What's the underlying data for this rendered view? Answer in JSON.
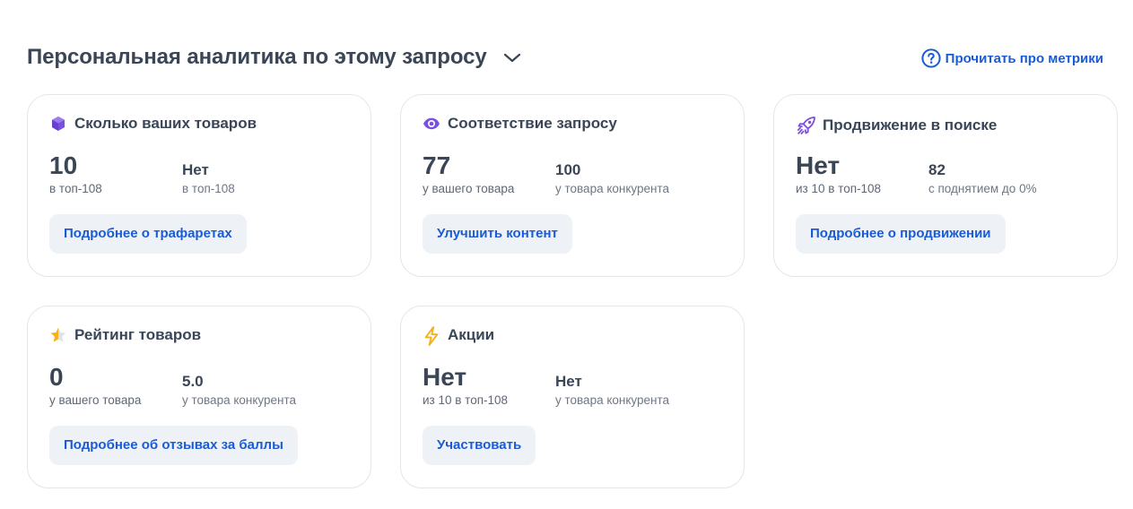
{
  "header": {
    "title": "Персональная аналитика по этому запросу",
    "help_link": "Прочитать про метрики"
  },
  "cards": [
    {
      "title": "Сколько ваших товаров",
      "icon": "cube-icon",
      "primary_value": "10",
      "primary_label": "в топ-108",
      "secondary_value": "Нет",
      "secondary_label": "в топ-108",
      "button": "Подробнее о трафаретах"
    },
    {
      "title": "Соответствие запросу",
      "icon": "eye-icon",
      "primary_value": "77",
      "primary_label": "у вашего товара",
      "secondary_value": "100",
      "secondary_label": "у товара конкурента",
      "button": "Улучшить контент"
    },
    {
      "title": "Продвижение в поиске",
      "icon": "rocket-icon",
      "primary_value": "Нет",
      "primary_label": "из 10 в топ-108",
      "secondary_value": "82",
      "secondary_label": "с поднятием до 0%",
      "button": "Подробнее о продвижении"
    },
    {
      "title": "Рейтинг товаров",
      "icon": "star-half-icon",
      "primary_value": "0",
      "primary_label": "у вашего товара",
      "secondary_value": "5.0",
      "secondary_label": "у товара конкурента",
      "button": "Подробнее об отзывах за баллы"
    },
    {
      "title": "Акции",
      "icon": "lightning-icon",
      "primary_value": "Нет",
      "primary_label": "из 10 в топ-108",
      "secondary_value": "Нет",
      "secondary_label": "у товара конкурента",
      "button": "Участвовать"
    }
  ],
  "colors": {
    "link_blue": "#1a5bd6",
    "purple": "#7b4fe0",
    "gold": "#f5b21a"
  }
}
